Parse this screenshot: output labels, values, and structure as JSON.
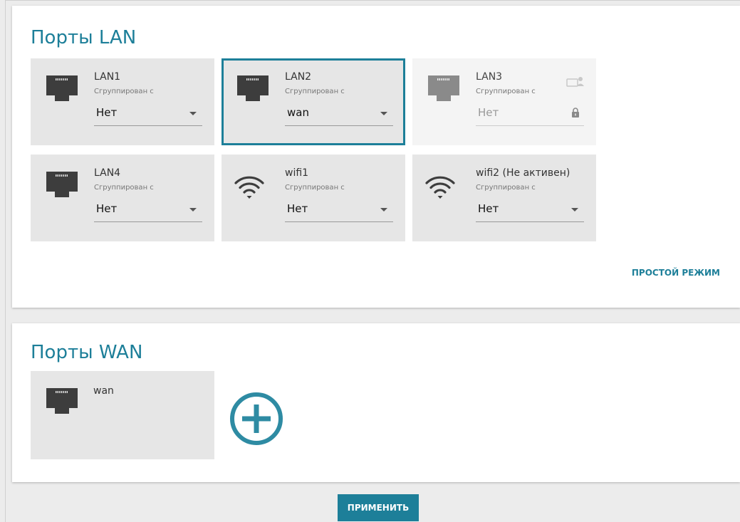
{
  "lan": {
    "title": "Порты LAN",
    "ports": [
      {
        "name": "LAN1",
        "sub": "Сгруппирован с",
        "value": "Нет",
        "icon": "ethernet-icon",
        "state": "normal"
      },
      {
        "name": "LAN2",
        "sub": "Сгруппирован с",
        "value": "wan",
        "icon": "ethernet-icon",
        "state": "selected"
      },
      {
        "name": "LAN3",
        "sub": "Сгруппирован с",
        "value": "Нет",
        "icon": "ethernet-icon",
        "state": "disabled"
      },
      {
        "name": "LAN4",
        "sub": "Сгруппирован с",
        "value": "Нет",
        "icon": "ethernet-icon",
        "state": "normal"
      },
      {
        "name": "wifi1",
        "sub": "Сгруппирован с",
        "value": "Нет",
        "icon": "wifi-icon",
        "state": "normal"
      },
      {
        "name": "wifi2 (Не активен)",
        "sub": "Сгруппирован с",
        "value": "Нет",
        "icon": "wifi-icon",
        "state": "normal"
      }
    ],
    "mode_link": "ПРОСТОЙ РЕЖИМ"
  },
  "wan": {
    "title": "Порты WAN",
    "ports": [
      {
        "name": "wan",
        "icon": "ethernet-icon"
      }
    ],
    "add_icon": "plus-circle-icon"
  },
  "apply_label": "ПРИМЕНИТЬ",
  "colors": {
    "accent": "#1d7f99",
    "card": "#e6e6e6",
    "card_disabled": "#f4f4f4",
    "icon_dark": "#3d3d3d",
    "icon_disabled": "#8a8a8a"
  }
}
